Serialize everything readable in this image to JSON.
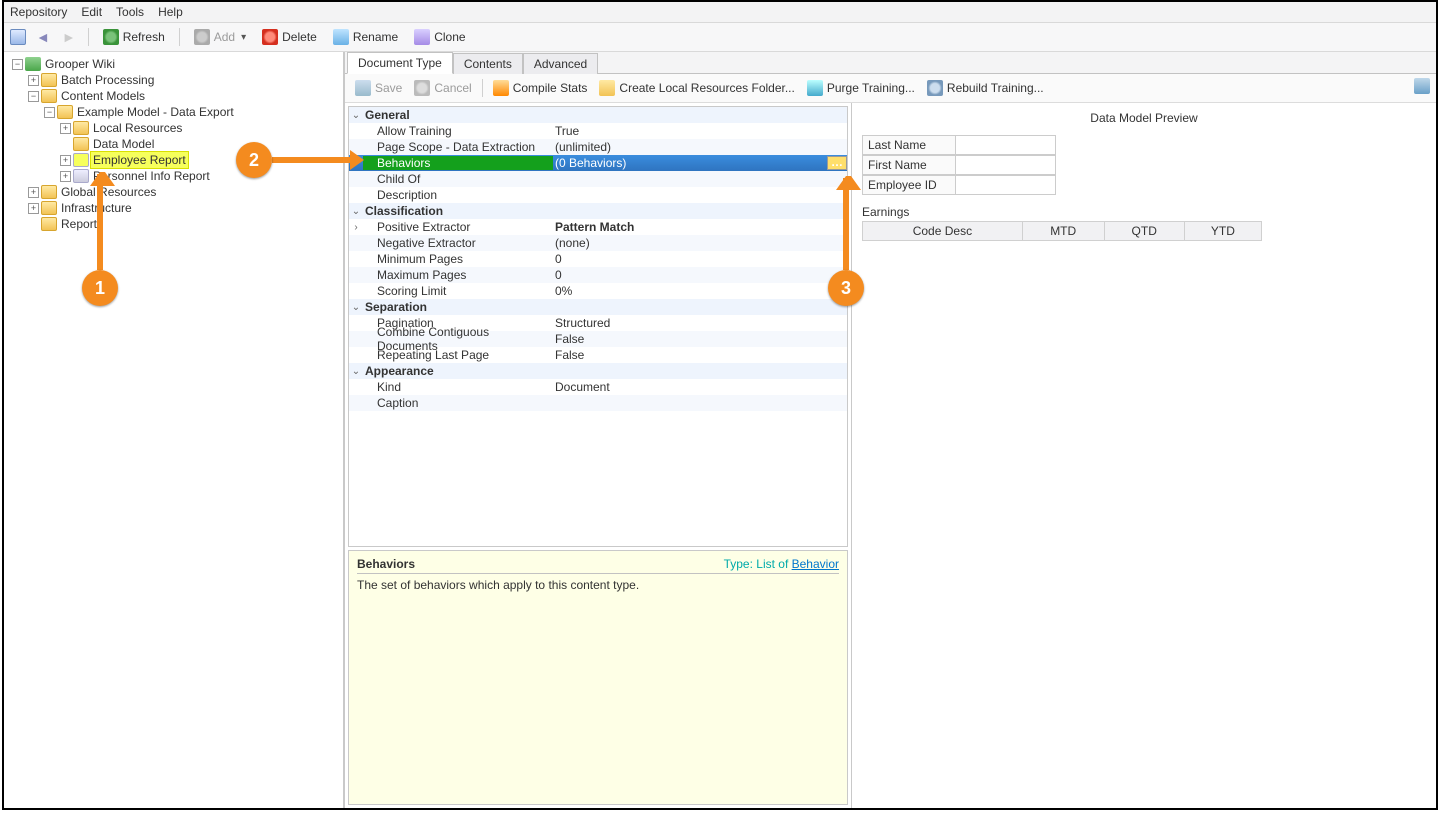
{
  "menu": {
    "repository": "Repository",
    "edit": "Edit",
    "tools": "Tools",
    "help": "Help"
  },
  "toolbar": {
    "refresh": "Refresh",
    "add": "Add",
    "delete": "Delete",
    "rename": "Rename",
    "clone": "Clone"
  },
  "tree": {
    "root": "Grooper Wiki",
    "batch_processing": "Batch Processing",
    "content_models": "Content Models",
    "example_model": "Example Model - Data Export",
    "local_resources": "Local Resources",
    "data_model": "Data Model",
    "employee_report": "Employee Report",
    "personnel_info_report": "Personnel Info Report",
    "global_resources": "Global Resources",
    "infrastructure": "Infrastructure",
    "reports": "Reports"
  },
  "tabs": {
    "doc_type": "Document Type",
    "contents": "Contents",
    "advanced": "Advanced"
  },
  "rtoolbar": {
    "save": "Save",
    "cancel": "Cancel",
    "compile": "Compile Stats",
    "create_local": "Create Local Resources Folder...",
    "purge": "Purge Training...",
    "rebuild": "Rebuild Training..."
  },
  "props": {
    "general": "General",
    "allow_training": {
      "name": "Allow Training",
      "value": "True"
    },
    "page_scope": {
      "name": "Page Scope - Data Extraction",
      "value": "(unlimited)"
    },
    "behaviors": {
      "name": "Behaviors",
      "value": "(0 Behaviors)"
    },
    "child_of": {
      "name": "Child Of",
      "value": ""
    },
    "description": {
      "name": "Description",
      "value": ""
    },
    "classification": "Classification",
    "positive_extractor": {
      "name": "Positive Extractor",
      "value": "Pattern Match"
    },
    "negative_extractor": {
      "name": "Negative Extractor",
      "value": "(none)"
    },
    "min_pages": {
      "name": "Minimum Pages",
      "value": "0"
    },
    "max_pages": {
      "name": "Maximum Pages",
      "value": "0"
    },
    "scoring_limit": {
      "name": "Scoring Limit",
      "value": "0%"
    },
    "separation": "Separation",
    "pagination": {
      "name": "Pagination",
      "value": "Structured"
    },
    "combine": {
      "name": "Combine Contiguous Documents",
      "value": "False"
    },
    "repeating": {
      "name": "Repeating Last Page",
      "value": "False"
    },
    "appearance": "Appearance",
    "kind": {
      "name": "Kind",
      "value": "Document"
    },
    "caption": {
      "name": "Caption",
      "value": ""
    }
  },
  "desc": {
    "title": "Behaviors",
    "type_label": "Type:",
    "type_value": "List of",
    "type_link": "Behavior",
    "body": "The set of behaviors which apply to this content type."
  },
  "preview": {
    "title": "Data Model Preview",
    "last_name": "Last Name",
    "first_name": "First Name",
    "employee_id": "Employee ID",
    "earnings": "Earnings",
    "cols": {
      "code": "Code Desc",
      "mtd": "MTD",
      "qtd": "QTD",
      "ytd": "YTD"
    }
  },
  "callouts": {
    "c1": "1",
    "c2": "2",
    "c3": "3"
  }
}
